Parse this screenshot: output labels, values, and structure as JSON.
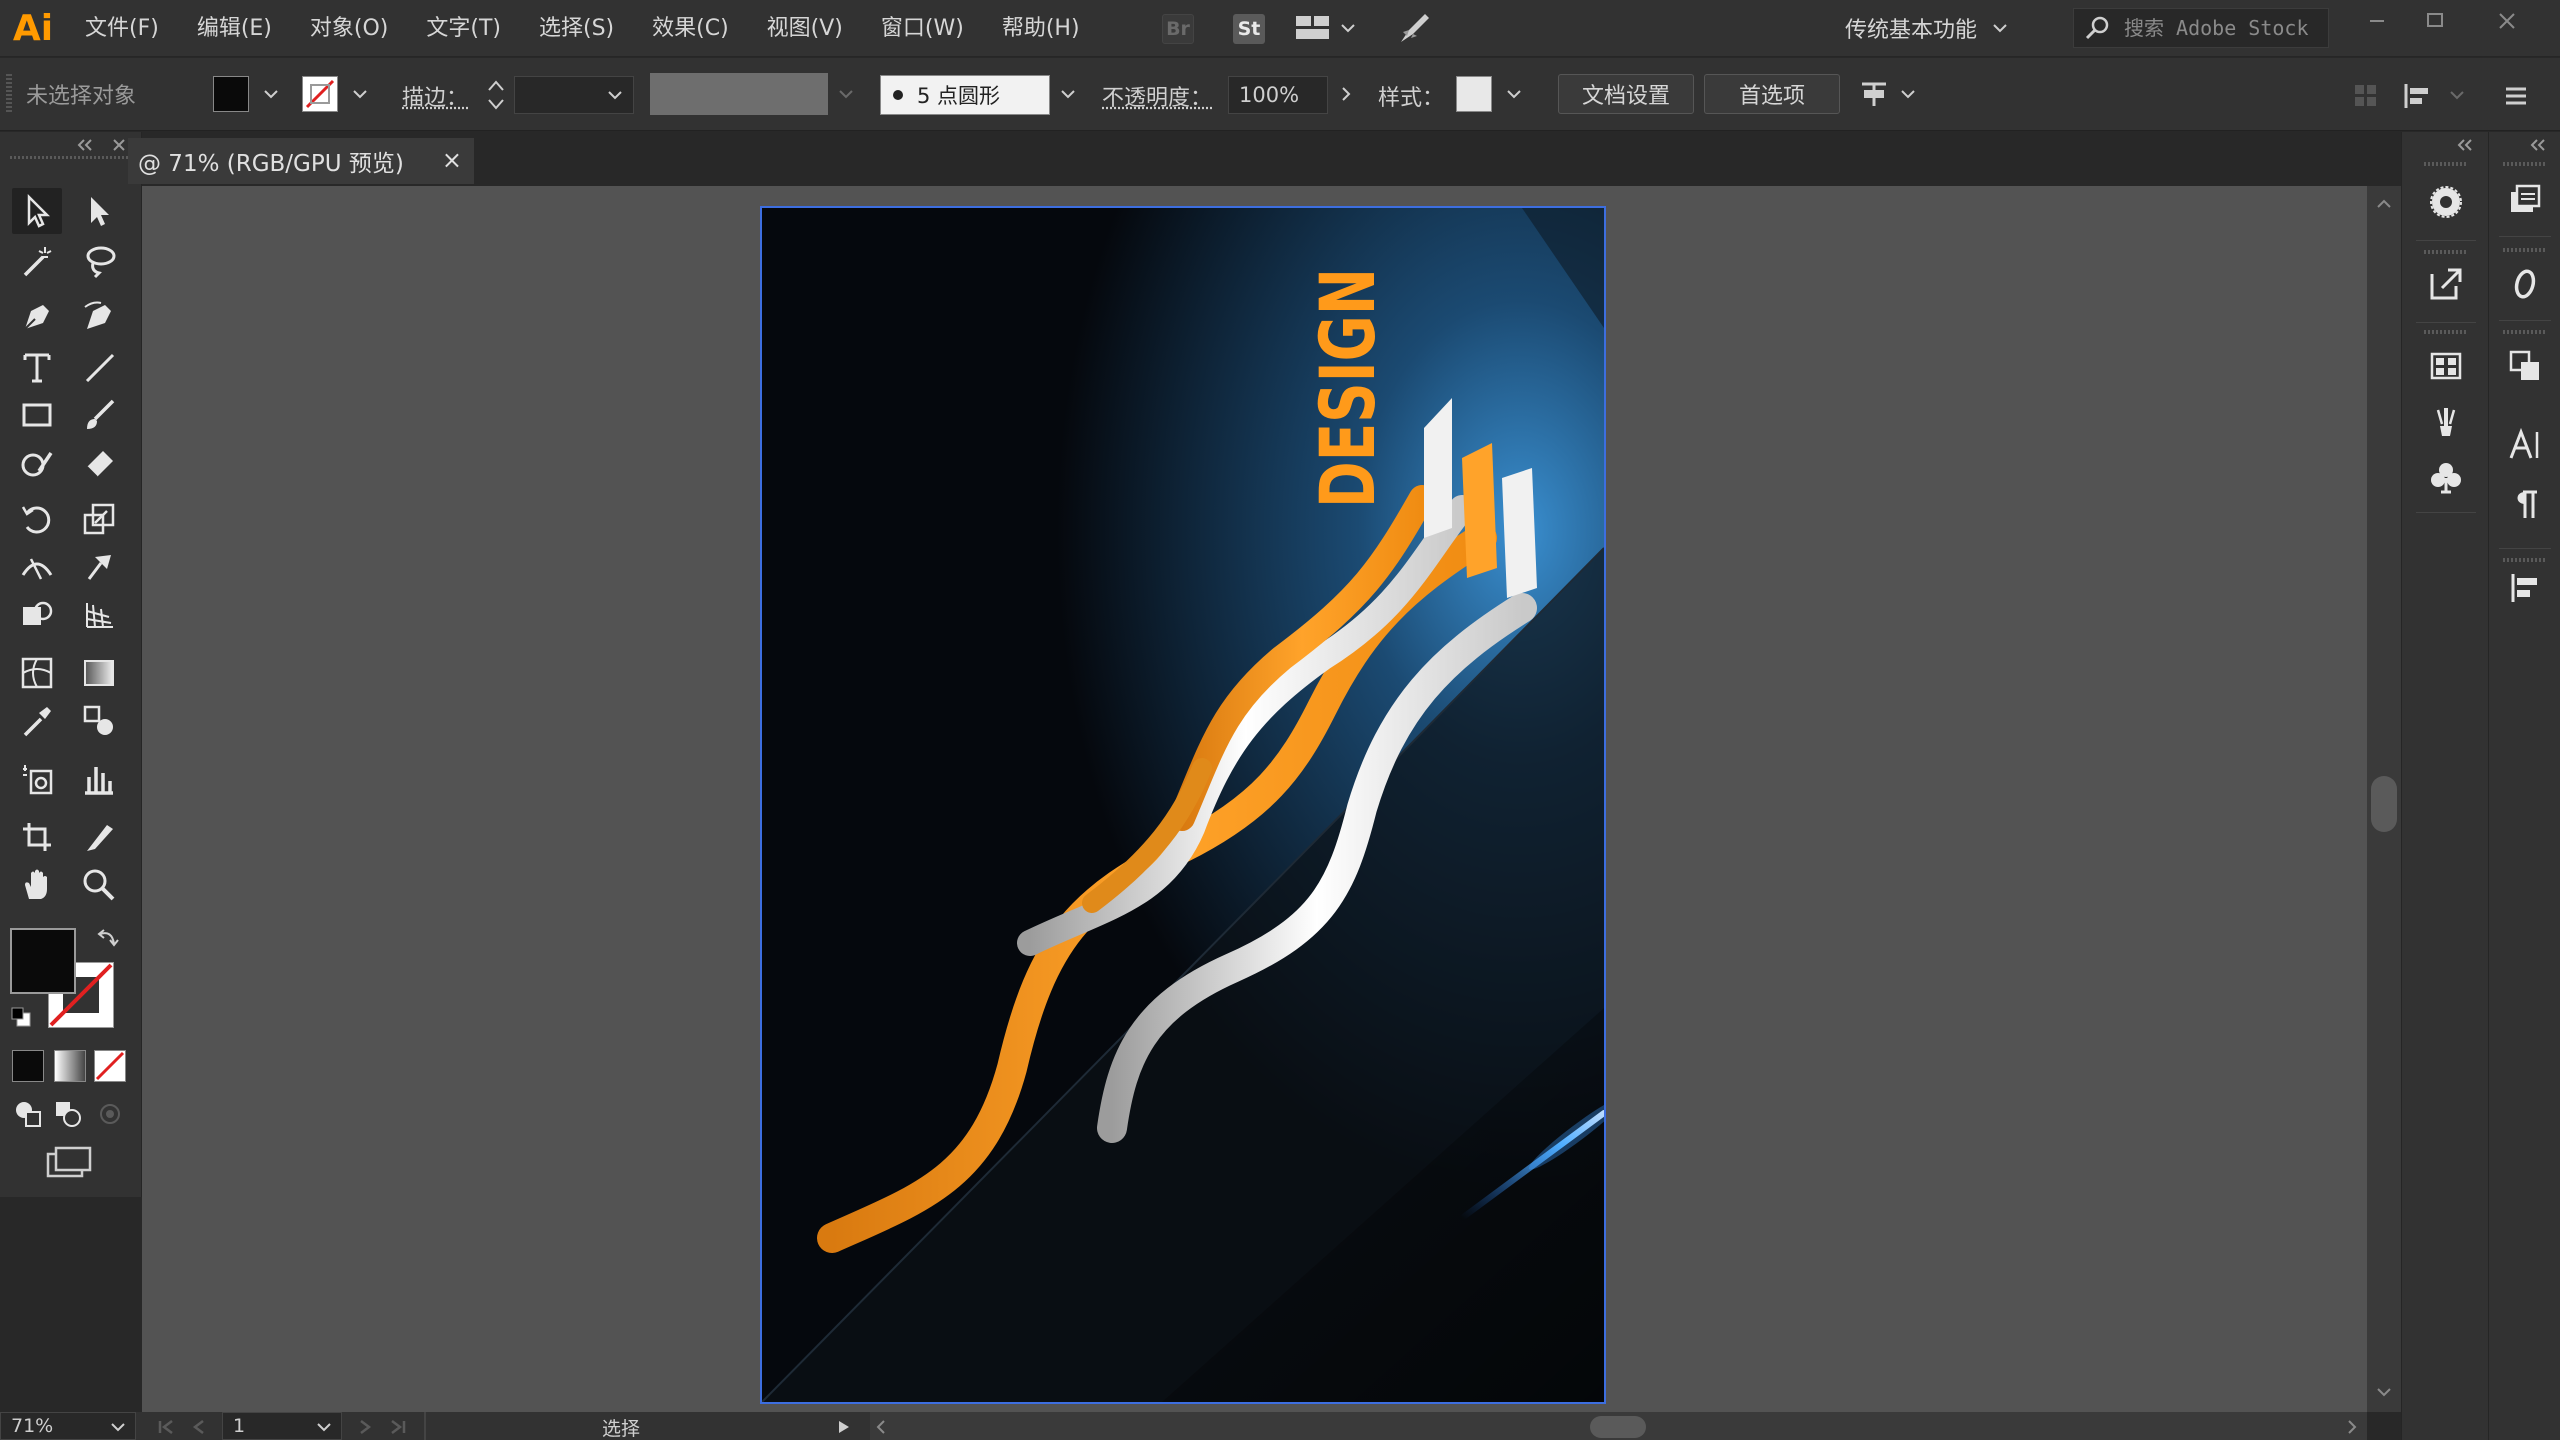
{
  "app": {
    "logo_text": "Ai",
    "accent": "#ff9a00"
  },
  "menu": {
    "items": [
      "文件(F)",
      "编辑(E)",
      "对象(O)",
      "文字(T)",
      "选择(S)",
      "效果(C)",
      "视图(V)",
      "窗口(W)",
      "帮助(H)"
    ],
    "bridge_label": "Br",
    "stock_label": "St",
    "workspace": "传统基本功能",
    "search_placeholder": "搜索 Adobe Stock"
  },
  "control_bar": {
    "selection_status": "未选择对象",
    "stroke_label": "描边",
    "brush_value": "5 点圆形",
    "opacity_label": "不透明度",
    "opacity_value": "100%",
    "style_label": "样式",
    "document_setup": "文档设置",
    "preferences": "首选项"
  },
  "document": {
    "tab_title": "@ 71% (RGB/GPU 预览)",
    "tab_close": "×",
    "artwork_text": "DESIGN"
  },
  "status_bar": {
    "zoom": "71%",
    "page": "1",
    "tool": "选择"
  },
  "icons": {
    "tools": [
      "selection-icon",
      "direct-selection-icon",
      "magic-wand-icon",
      "lasso-icon",
      "pen-icon",
      "curvature-icon",
      "type-icon",
      "line-segment-icon",
      "rectangle-icon",
      "paintbrush-icon",
      "shaper-icon",
      "eraser-icon",
      "rotate-icon",
      "scale-icon",
      "width-icon",
      "puppet-warp-icon",
      "shape-builder-icon",
      "perspective-grid-icon",
      "mesh-icon",
      "gradient-icon",
      "eyedropper-icon",
      "blend-icon",
      "symbol-sprayer-icon",
      "column-graph-icon",
      "artboard-icon",
      "slice-icon",
      "hand-icon",
      "zoom-icon"
    ],
    "panels": [
      "color-icon",
      "libraries-icon",
      "export-icon",
      "appearance-icon",
      "swatches-icon",
      "layers-icon",
      "symbols-icon",
      "character-icon",
      "brushes-icon",
      "paragraph-icon",
      "align-icon"
    ]
  }
}
